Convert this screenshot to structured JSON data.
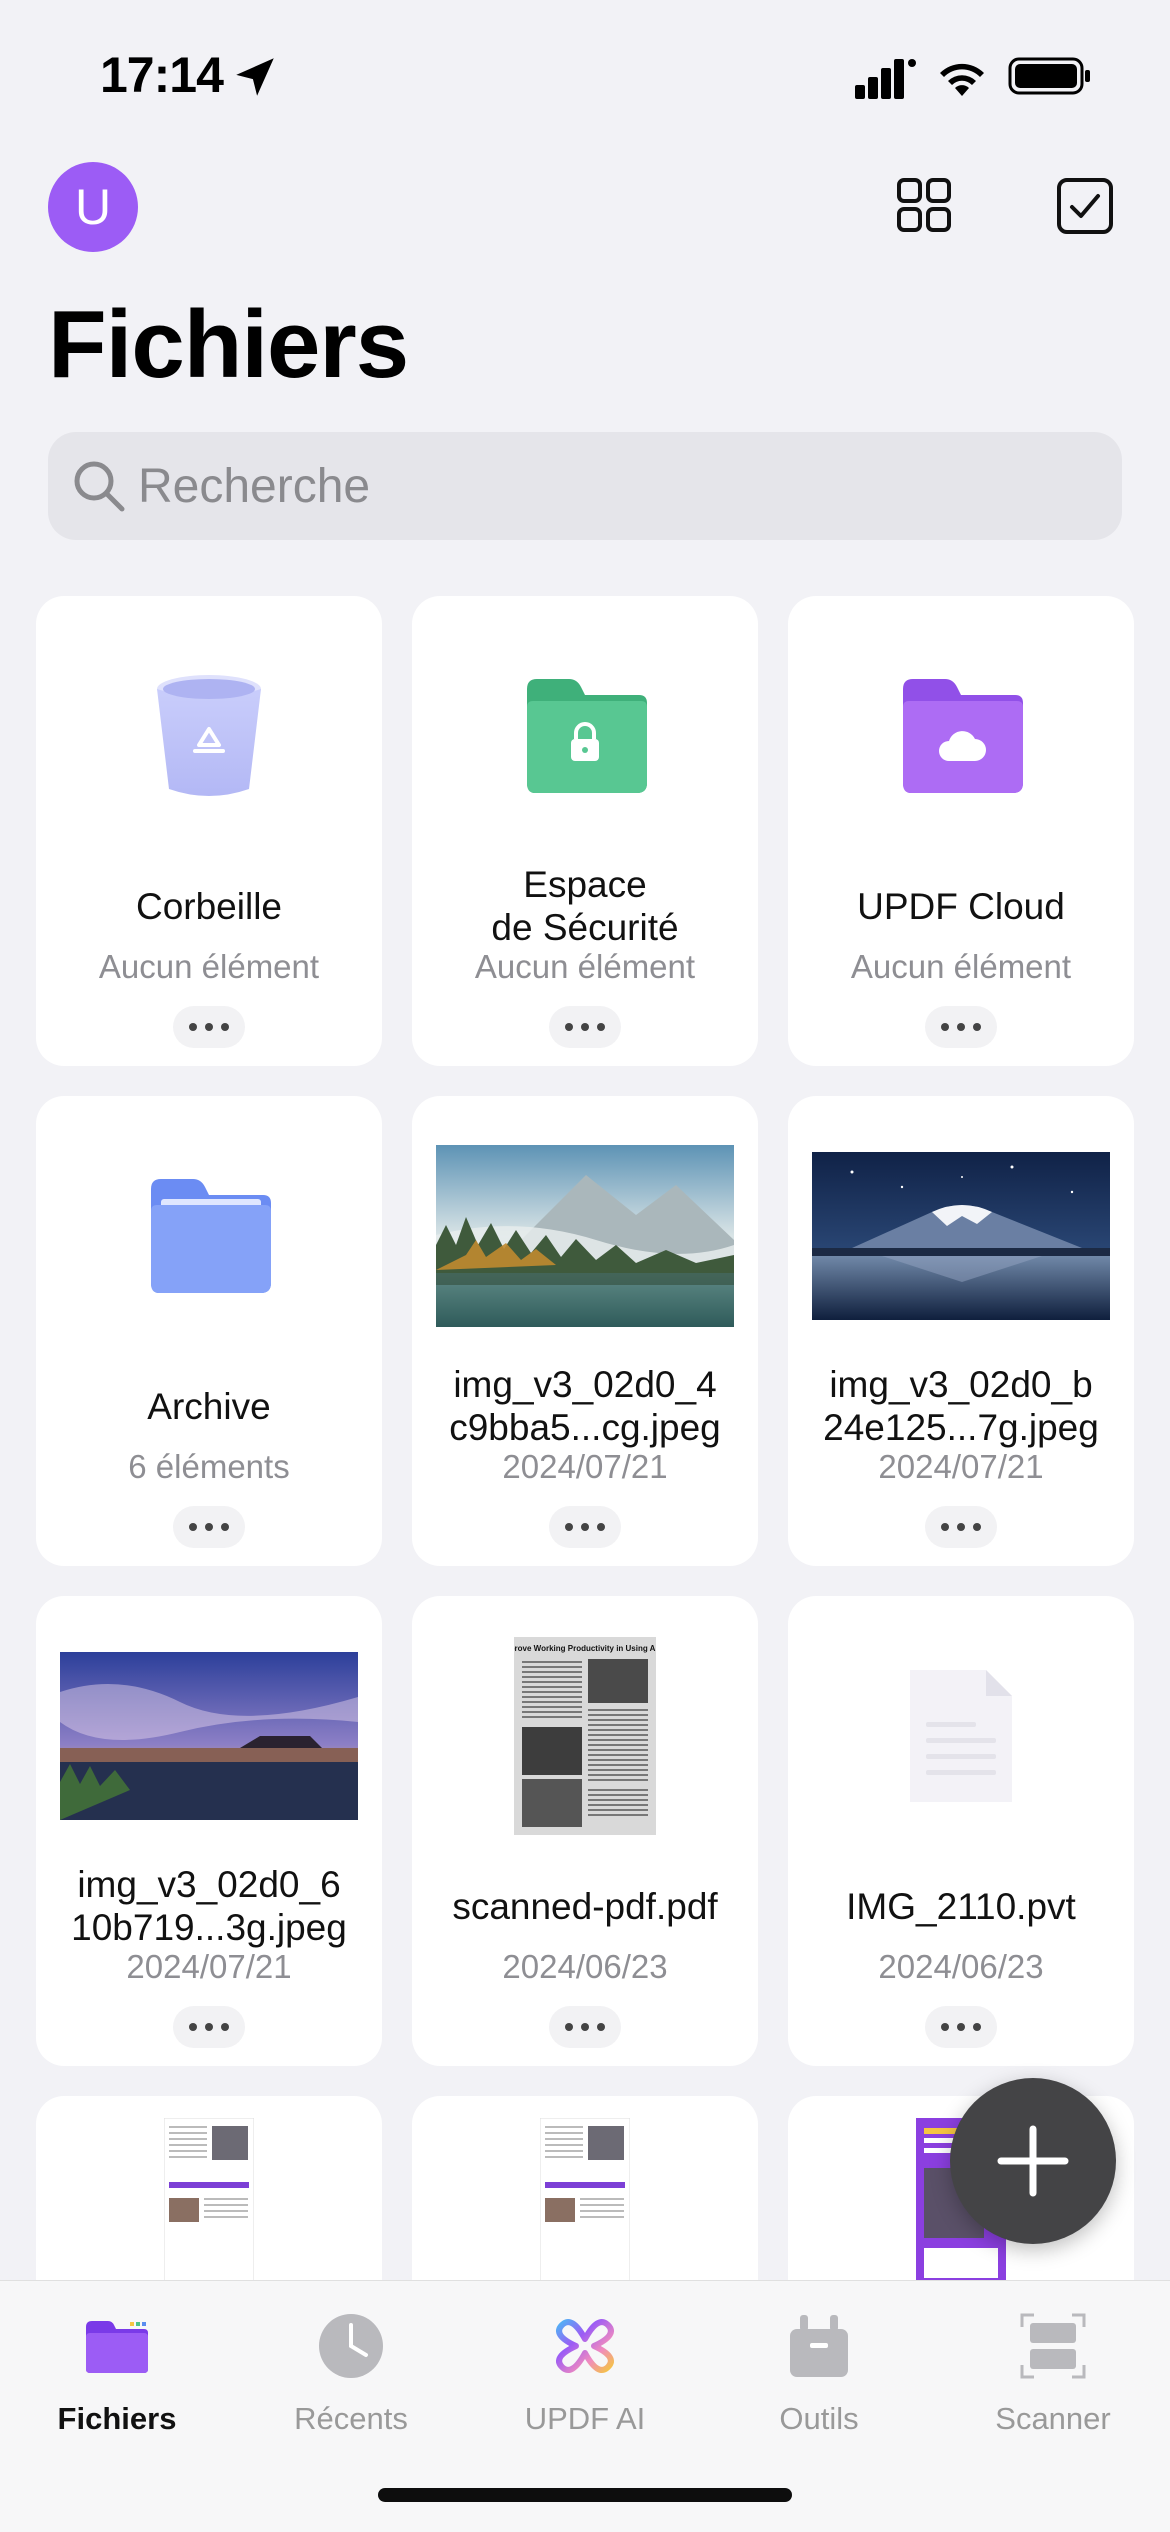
{
  "status_bar": {
    "time": "17:14"
  },
  "header": {
    "avatar_letter": "U",
    "title": "Fichiers"
  },
  "search": {
    "placeholder": "Recherche"
  },
  "files": [
    {
      "name": "Corbeille",
      "meta": "Aucun élément",
      "icon": "trash-bin-icon"
    },
    {
      "name": "Espace\nde Sécurité",
      "meta": "Aucun élément",
      "icon": "secure-folder-icon"
    },
    {
      "name": "UPDF Cloud",
      "meta": "Aucun élément",
      "icon": "cloud-folder-icon"
    },
    {
      "name": "Archive",
      "meta": "6 éléments",
      "icon": "folder-icon"
    },
    {
      "name": "img_v3_02d0_4\nc9bba5...cg.jpeg",
      "meta": "2024/07/21",
      "icon": "misty-lake-thumbnail"
    },
    {
      "name": "img_v3_02d0_b\n24e125...7g.jpeg",
      "meta": "2024/07/21",
      "icon": "snowy-mountain-thumbnail"
    },
    {
      "name": "img_v3_02d0_6\n10b719...3g.jpeg",
      "meta": "2024/07/21",
      "icon": "sunset-landscape-thumbnail"
    },
    {
      "name": "scanned-pdf.pdf",
      "meta": "2024/06/23",
      "icon": "scanned-document-thumbnail"
    },
    {
      "name": "IMG_2110.pvt",
      "meta": "2024/06/23",
      "icon": "blank-document-icon"
    }
  ],
  "thumbnail_text": {
    "scanned_pdf_title": "Improve Working Productivity in Using Apps"
  },
  "fab": {
    "icon": "plus-icon"
  },
  "tabs": [
    {
      "label": "Fichiers",
      "icon": "folder-tab-icon",
      "active": true
    },
    {
      "label": "Récents",
      "icon": "clock-icon",
      "active": false
    },
    {
      "label": "UPDF AI",
      "icon": "ai-flower-icon",
      "active": false
    },
    {
      "label": "Outils",
      "icon": "toolbox-icon",
      "active": false
    },
    {
      "label": "Scanner",
      "icon": "scan-icon",
      "active": false
    }
  ],
  "colors": {
    "accent": "#9c5cf5",
    "secure_green": "#4cc38a",
    "cloud_purple": "#a55ef0",
    "archive_blue": "#7d9cf7"
  }
}
